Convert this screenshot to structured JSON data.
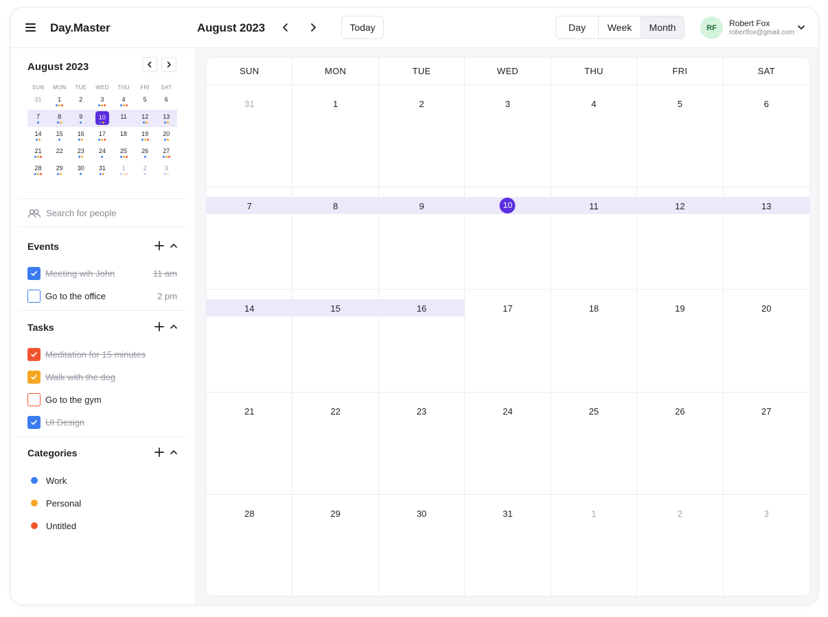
{
  "app": {
    "name": "Day.Master"
  },
  "header": {
    "current_month": "August 2023",
    "today_label": "Today",
    "views": [
      {
        "label": "Day",
        "active": false
      },
      {
        "label": "Week",
        "active": false
      },
      {
        "label": "Month",
        "active": true
      }
    ],
    "user": {
      "initials": "RF",
      "name": "Robert Fox",
      "email": "robertfox@gmail.com"
    }
  },
  "mini_calendar": {
    "title": "August 2023",
    "weekdays": [
      "SUN",
      "MON",
      "TUE",
      "WED",
      "THU",
      "FRI",
      "SAT"
    ],
    "dot_colors": {
      "b": "#3b7cf0",
      "y": "#f5a623",
      "r": "#f0542e"
    },
    "weeks": [
      {
        "highlight": false,
        "days": [
          {
            "n": "31",
            "muted": true,
            "dots": ""
          },
          {
            "n": "1",
            "dots": "byr"
          },
          {
            "n": "2",
            "dots": ""
          },
          {
            "n": "3",
            "dots": "byr"
          },
          {
            "n": "4",
            "dots": "byr"
          },
          {
            "n": "5",
            "dots": ""
          },
          {
            "n": "6",
            "dots": ""
          }
        ]
      },
      {
        "highlight": true,
        "days": [
          {
            "n": "7",
            "dots": "b"
          },
          {
            "n": "8",
            "dots": "by"
          },
          {
            "n": "9",
            "dots": "b"
          },
          {
            "n": "10",
            "selected": true,
            "dots": "by"
          },
          {
            "n": "11",
            "dots": ""
          },
          {
            "n": "12",
            "dots": "by"
          },
          {
            "n": "13",
            "dots": "by"
          }
        ]
      },
      {
        "highlight": false,
        "days": [
          {
            "n": "14",
            "dots": "by"
          },
          {
            "n": "15",
            "dots": "b"
          },
          {
            "n": "16",
            "dots": "by"
          },
          {
            "n": "17",
            "dots": "byr"
          },
          {
            "n": "18",
            "dots": ""
          },
          {
            "n": "19",
            "dots": "byr"
          },
          {
            "n": "20",
            "dots": "by"
          }
        ]
      },
      {
        "highlight": false,
        "days": [
          {
            "n": "21",
            "dots": "byr"
          },
          {
            "n": "22",
            "dots": ""
          },
          {
            "n": "23",
            "dots": "by"
          },
          {
            "n": "24",
            "dots": "b"
          },
          {
            "n": "25",
            "dots": "byr"
          },
          {
            "n": "26",
            "dots": "b"
          },
          {
            "n": "27",
            "dots": "byr"
          }
        ]
      },
      {
        "highlight": false,
        "days": [
          {
            "n": "28",
            "dots": "byr"
          },
          {
            "n": "29",
            "dots": "by"
          },
          {
            "n": "30",
            "dots": "b"
          },
          {
            "n": "31",
            "dots": "by"
          },
          {
            "n": "1",
            "muted": true,
            "dots": "byr"
          },
          {
            "n": "2",
            "muted": true,
            "dots": "b"
          },
          {
            "n": "3",
            "muted": true,
            "dots": "by"
          }
        ]
      }
    ]
  },
  "search": {
    "placeholder": "Search for people"
  },
  "events": {
    "title": "Events",
    "items": [
      {
        "label": "Meeting wih John",
        "time": "11 am",
        "done": true,
        "color": "#3b7cf0"
      },
      {
        "label": "Go to the office",
        "time": "2 pm",
        "done": false,
        "color": "#3b7cf0"
      }
    ]
  },
  "tasks": {
    "title": "Tasks",
    "items": [
      {
        "label": "Meditation for 15 minutes",
        "done": true,
        "color": "#f0542e"
      },
      {
        "label": "Walk with the dog",
        "done": true,
        "color": "#f5a623"
      },
      {
        "label": "Go to the gym",
        "done": false,
        "color": "#f0542e"
      },
      {
        "label": "UI Design",
        "done": true,
        "color": "#3b7cf0"
      }
    ]
  },
  "categories": {
    "title": "Categories",
    "items": [
      {
        "label": "Work",
        "color": "#3b7cf0"
      },
      {
        "label": "Personal",
        "color": "#f5a623"
      },
      {
        "label": "Untitled",
        "color": "#f0542e"
      }
    ]
  },
  "month_view": {
    "weekdays": [
      "SUN",
      "MON",
      "TUE",
      "WED",
      "THU",
      "FRI",
      "SAT"
    ],
    "accent": "#5b2ee0",
    "highlight_band": "#ece9fb",
    "weeks": [
      [
        {
          "n": "31",
          "muted": true
        },
        {
          "n": "1"
        },
        {
          "n": "2"
        },
        {
          "n": "3"
        },
        {
          "n": "4"
        },
        {
          "n": "5"
        },
        {
          "n": "6"
        }
      ],
      [
        {
          "n": "7",
          "band": true
        },
        {
          "n": "8",
          "band": true
        },
        {
          "n": "9",
          "band": true
        },
        {
          "n": "10",
          "today": true,
          "band": true
        },
        {
          "n": "11",
          "band": true
        },
        {
          "n": "12",
          "band": true
        },
        {
          "n": "13",
          "band": true
        }
      ],
      [
        {
          "n": "14",
          "band": true
        },
        {
          "n": "15",
          "band": true
        },
        {
          "n": "16",
          "band": true
        },
        {
          "n": "17"
        },
        {
          "n": "18"
        },
        {
          "n": "19"
        },
        {
          "n": "20"
        }
      ],
      [
        {
          "n": "21"
        },
        {
          "n": "22"
        },
        {
          "n": "23"
        },
        {
          "n": "24"
        },
        {
          "n": "25"
        },
        {
          "n": "26"
        },
        {
          "n": "27"
        }
      ],
      [
        {
          "n": "28"
        },
        {
          "n": "29"
        },
        {
          "n": "30"
        },
        {
          "n": "31"
        },
        {
          "n": "1",
          "muted": true
        },
        {
          "n": "2",
          "muted": true
        },
        {
          "n": "3",
          "muted": true
        }
      ]
    ]
  }
}
